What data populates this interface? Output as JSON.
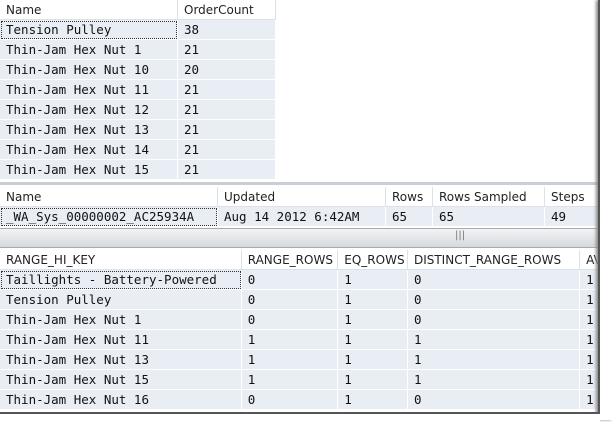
{
  "results": {
    "columns": [
      "Name",
      "OrderCount"
    ],
    "rows": [
      [
        "Tension Pulley",
        "38"
      ],
      [
        "Thin-Jam Hex Nut 1",
        "21"
      ],
      [
        "Thin-Jam Hex Nut 10",
        "20"
      ],
      [
        "Thin-Jam Hex Nut 11",
        "21"
      ],
      [
        "Thin-Jam Hex Nut 12",
        "21"
      ],
      [
        "Thin-Jam Hex Nut 13",
        "21"
      ],
      [
        "Thin-Jam Hex Nut 14",
        "21"
      ],
      [
        "Thin-Jam Hex Nut 15",
        "21"
      ]
    ]
  },
  "stats_header": {
    "columns": [
      "Name",
      "Updated",
      "Rows",
      "Rows Sampled",
      "Steps"
    ],
    "rows": [
      [
        "_WA_Sys_00000002_AC25934A",
        "Aug 14 2012  6:42AM",
        "65",
        "65",
        "49"
      ]
    ]
  },
  "splitter_grip": "|||",
  "histogram": {
    "columns": [
      "RANGE_HI_KEY",
      "RANGE_ROWS",
      "EQ_ROWS",
      "DISTINCT_RANGE_ROWS",
      "AV"
    ],
    "rows": [
      [
        "Taillights - Battery-Powered",
        "0",
        "1",
        "0",
        "1"
      ],
      [
        "Tension Pulley",
        "0",
        "1",
        "0",
        "1"
      ],
      [
        "Thin-Jam Hex Nut 1",
        "0",
        "1",
        "0",
        "1"
      ],
      [
        "Thin-Jam Hex Nut 11",
        "1",
        "1",
        "1",
        "1"
      ],
      [
        "Thin-Jam Hex Nut 13",
        "1",
        "1",
        "1",
        "1"
      ],
      [
        "Thin-Jam Hex Nut 15",
        "1",
        "1",
        "1",
        "1"
      ],
      [
        "Thin-Jam Hex Nut 16",
        "0",
        "1",
        "0",
        "1"
      ]
    ]
  }
}
